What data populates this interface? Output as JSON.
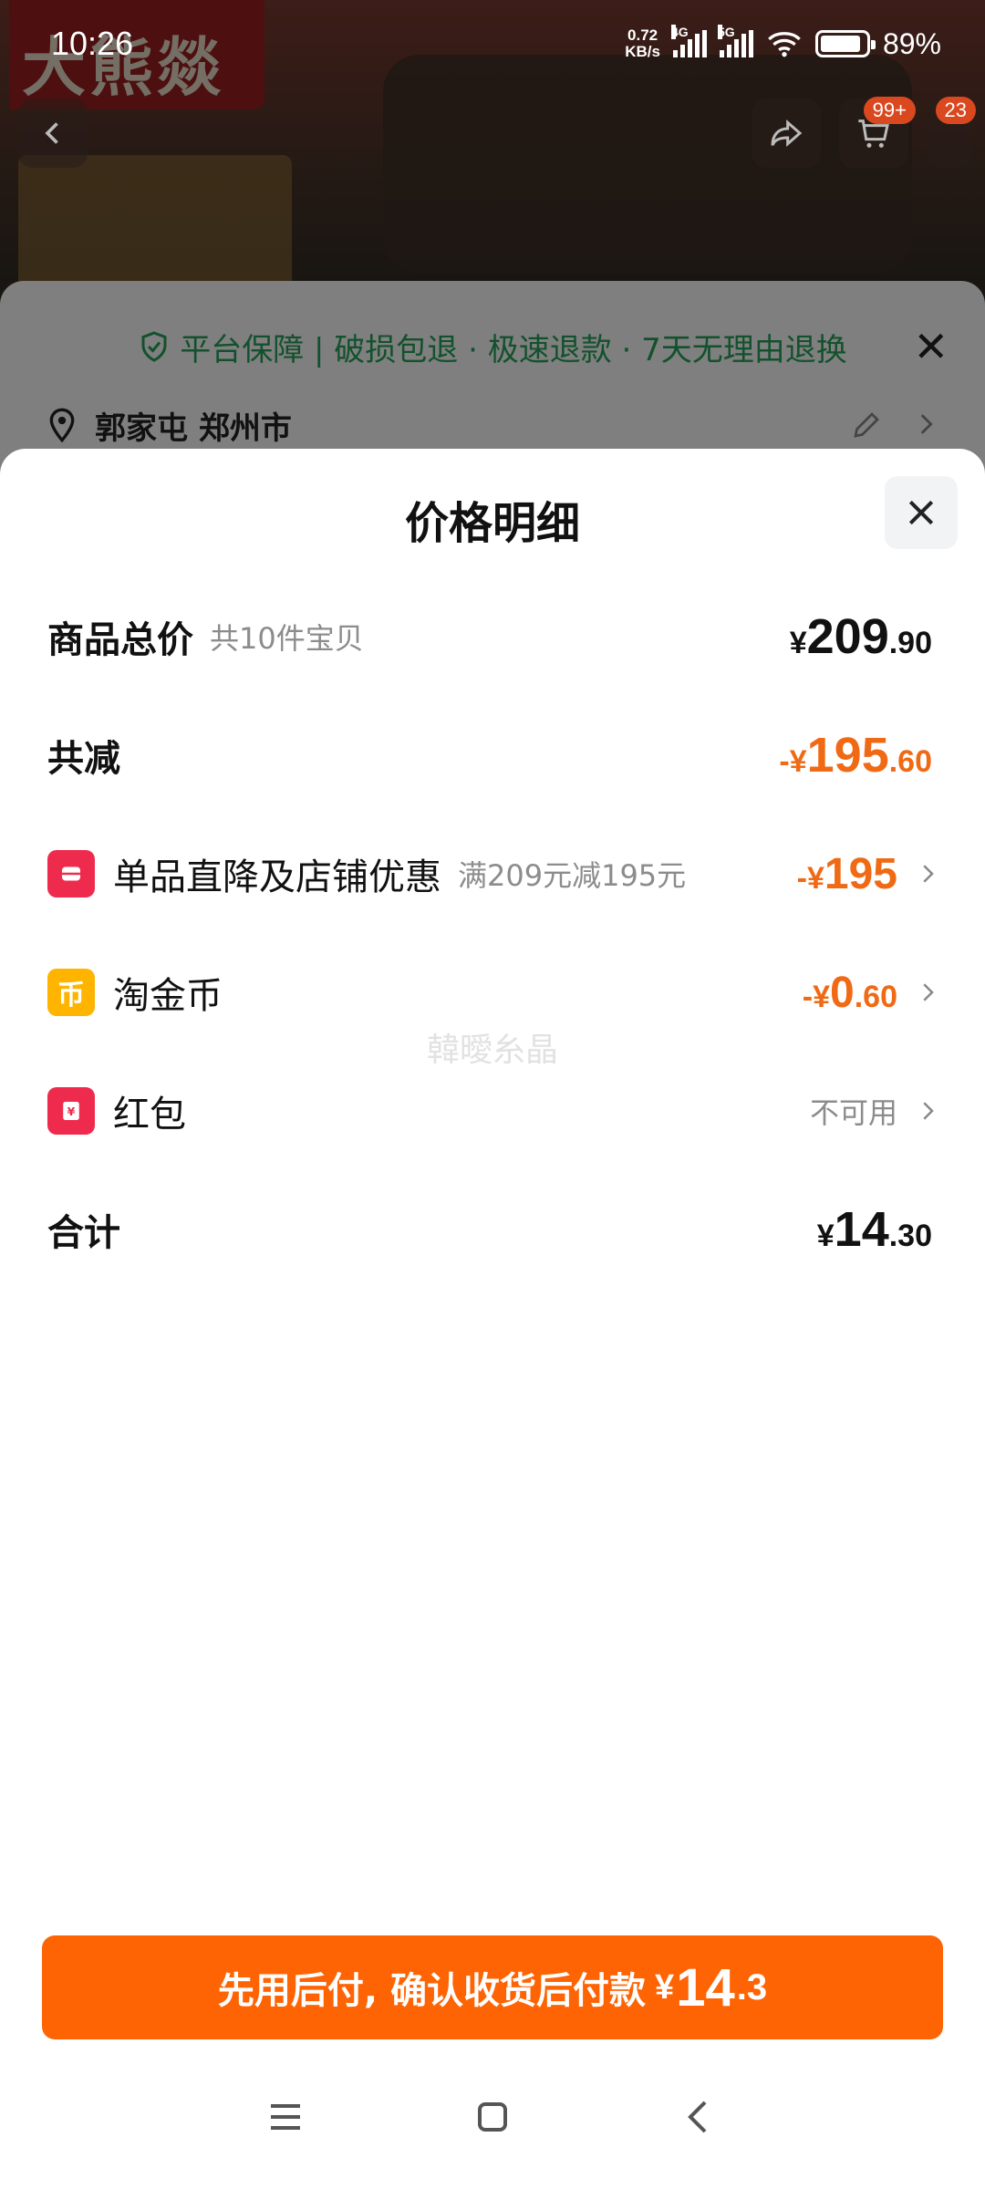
{
  "status_bar": {
    "time": "10:26",
    "net_speed_value": "0.72",
    "net_speed_unit": "KB/s",
    "sig1_label": "4G",
    "sig2_label": "5G",
    "battery": "89%"
  },
  "background": {
    "logo_text": "大熊燚",
    "cart_badge": "99+",
    "msg_badge": "23",
    "guarantee": "平台保障 | 破损包退 · 极速退款 · 7天无理由退换",
    "address": "郭家屯 郑州市"
  },
  "sheet": {
    "title": "价格明细",
    "rows": [
      {
        "label": "商品总价",
        "sub": "共10件宝贝",
        "cur": "¥",
        "int": "209",
        "dec": ".90"
      },
      {
        "label": "共减",
        "cur": "-¥",
        "int": "195",
        "dec": ".60"
      },
      {
        "label": "单品直降及店铺优惠",
        "sub": "满209元减195元",
        "cur": "-¥",
        "int": "195",
        "dec": ""
      },
      {
        "label": "淘金币",
        "cur": "-¥",
        "int": "0",
        "dec": ".60"
      },
      {
        "label": "红包",
        "status": "不可用"
      },
      {
        "label": "合计",
        "cur": "¥",
        "int": "14",
        "dec": ".30"
      }
    ],
    "watermark": "韓曖糸晶",
    "pay_button": {
      "text": "先用后付, 确认收货后付款",
      "cur": "¥",
      "int": "14",
      "dec": ".3"
    }
  },
  "colors": {
    "accent_orange": "#ff6404",
    "discount_orange": "#f06a15",
    "guarantee_green": "#27a35a"
  }
}
